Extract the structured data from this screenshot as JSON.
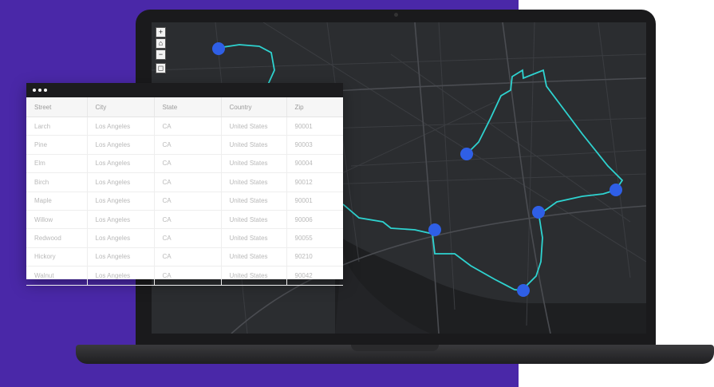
{
  "map": {
    "controls": [
      {
        "id": "zoom-in",
        "glyph": "+"
      },
      {
        "id": "home",
        "glyph": "⌂"
      },
      {
        "id": "zoom-out",
        "glyph": "−"
      },
      {
        "id": "locate",
        "glyph": "◻"
      }
    ],
    "route_color": "#2ed3d0",
    "marker_color": "#2f5fe6"
  },
  "table": {
    "columns": [
      "Street",
      "City",
      "State",
      "Country",
      "Zip"
    ],
    "rows": [
      [
        "Larch",
        "Los Angeles",
        "CA",
        "United States",
        "90001"
      ],
      [
        "Pine",
        "Los Angeles",
        "CA",
        "United States",
        "90003"
      ],
      [
        "Elm",
        "Los Angeles",
        "CA",
        "United States",
        "90004"
      ],
      [
        "Birch",
        "Los Angeles",
        "CA",
        "United States",
        "90012"
      ],
      [
        "Maple",
        "Los Angeles",
        "CA",
        "United States",
        "90001"
      ],
      [
        "Willow",
        "Los Angeles",
        "CA",
        "United States",
        "90006"
      ],
      [
        "Redwood",
        "Los Angeles",
        "CA",
        "United States",
        "90055"
      ],
      [
        "Hickory",
        "Los Angeles",
        "CA",
        "United States",
        "90210"
      ],
      [
        "Walnut",
        "Los Angeles",
        "CA",
        "United States",
        "90042"
      ]
    ]
  },
  "colors": {
    "background": "#4a28a8",
    "screen": "#2b2d30",
    "laptop": "#1a1a1c"
  }
}
